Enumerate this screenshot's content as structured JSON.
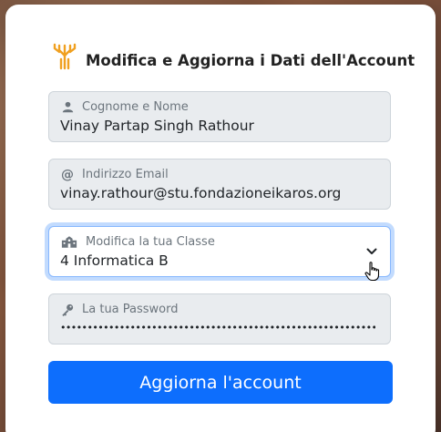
{
  "header": {
    "title": "Modifica e Aggiorna i Dati dell'Account",
    "logo_icon": "tree-logo-icon"
  },
  "form": {
    "name_field": {
      "label": "Cognome e Nome",
      "value": "Vinay Partap Singh Rathour",
      "icon": "user-icon"
    },
    "email_field": {
      "label": "Indirizzo Email",
      "value": "vinay.rathour@stu.fondazioneikaros.org",
      "icon": "at-icon"
    },
    "class_select": {
      "label": "Modifica la tua Classe",
      "selected": "4 Informatica B",
      "icon": "school-icon"
    },
    "password_field": {
      "label": "La tua Password",
      "value": "••••••••••••••••••••••••••••••••••••••••••••••••••••••••••••••••",
      "icon": "key-icon"
    },
    "submit_label": "Aggiorna l'account"
  },
  "colors": {
    "accent": "#0d6efd",
    "logo": "#f0a020",
    "field_bg": "#e9ecef"
  }
}
